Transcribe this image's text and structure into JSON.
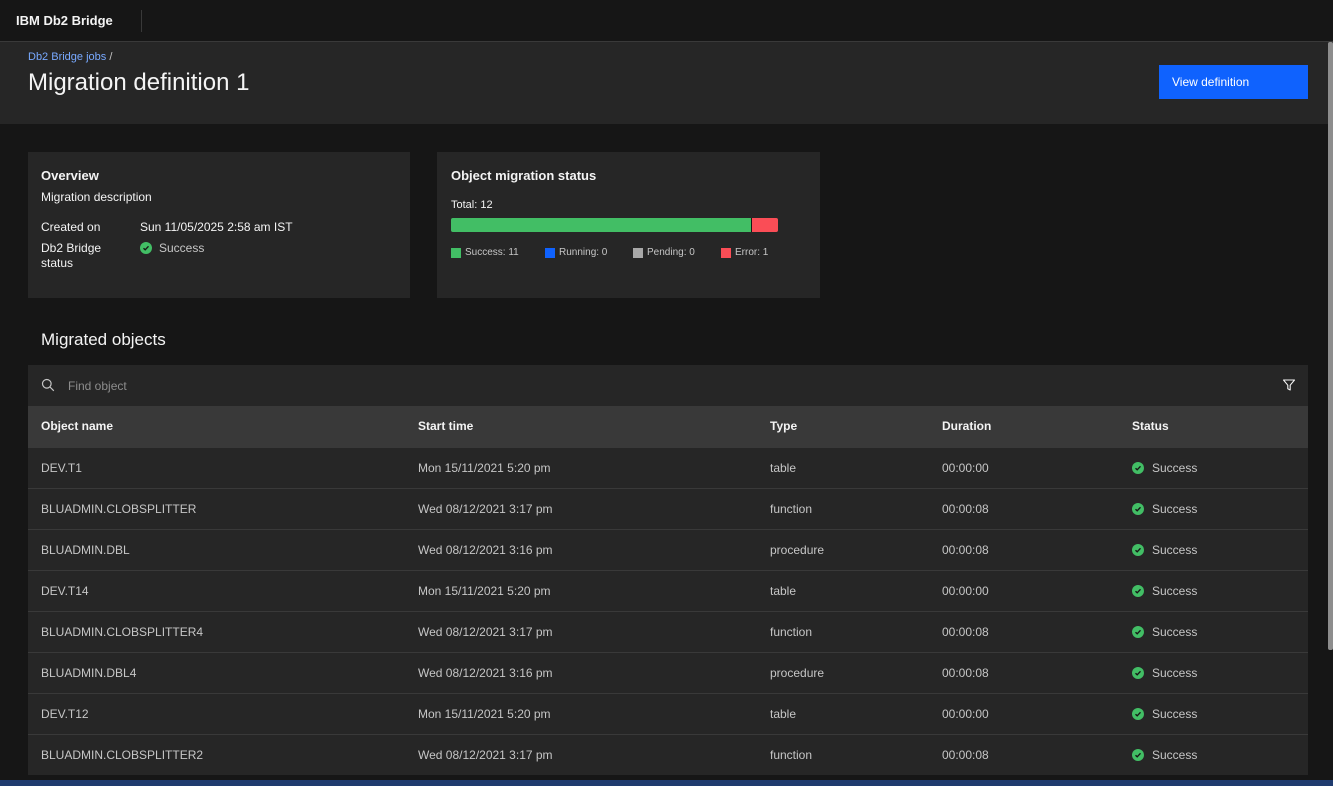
{
  "app": {
    "brand": "IBM Db2 Bridge"
  },
  "header": {
    "breadcrumb_link": "Db2 Bridge jobs",
    "breadcrumb_sep": "/",
    "title": "Migration definition 1",
    "view_button": "View definition"
  },
  "overview": {
    "title": "Overview",
    "description": "Migration description",
    "created_label": "Created on",
    "created_value": "Sun 11/05/2025 2:58 am IST",
    "status_label": "Db2 Bridge status",
    "status_value": "Success"
  },
  "migration_status": {
    "title": "Object migration status",
    "total_label": "Total: 12",
    "total": 12,
    "segments": [
      {
        "key": "success",
        "label": "Success: 11",
        "value": 11,
        "color": "#42be65"
      },
      {
        "key": "running",
        "label": "Running: 0",
        "value": 0,
        "color": "#0f62fe"
      },
      {
        "key": "pending",
        "label": "Pending: 0",
        "value": 0,
        "color": "#a8a8a8"
      },
      {
        "key": "error",
        "label": "Error: 1",
        "value": 1,
        "color": "#fa4d56"
      }
    ]
  },
  "objects": {
    "title": "Migrated objects",
    "search_placeholder": "Find object",
    "columns": [
      "Object name",
      "Start time",
      "Type",
      "Duration",
      "Status"
    ],
    "rows": [
      {
        "name": "DEV.T1",
        "start": "Mon 15/11/2021 5:20 pm",
        "type": "table",
        "duration": "00:00:00",
        "status": "Success"
      },
      {
        "name": "BLUADMIN.CLOBSPLITTER",
        "start": "Wed 08/12/2021 3:17 pm",
        "type": "function",
        "duration": "00:00:08",
        "status": "Success"
      },
      {
        "name": "BLUADMIN.DBL",
        "start": "Wed 08/12/2021 3:16 pm",
        "type": "procedure",
        "duration": "00:00:08",
        "status": "Success"
      },
      {
        "name": "DEV.T14",
        "start": "Mon 15/11/2021 5:20 pm",
        "type": "table",
        "duration": "00:00:00",
        "status": "Success"
      },
      {
        "name": "BLUADMIN.CLOBSPLITTER4",
        "start": "Wed 08/12/2021 3:17 pm",
        "type": "function",
        "duration": "00:00:08",
        "status": "Success"
      },
      {
        "name": "BLUADMIN.DBL4",
        "start": "Wed 08/12/2021 3:16 pm",
        "type": "procedure",
        "duration": "00:00:08",
        "status": "Success"
      },
      {
        "name": "DEV.T12",
        "start": "Mon 15/11/2021 5:20 pm",
        "type": "table",
        "duration": "00:00:00",
        "status": "Success"
      },
      {
        "name": "BLUADMIN.CLOBSPLITTER2",
        "start": "Wed 08/12/2021 3:17 pm",
        "type": "function",
        "duration": "00:00:08",
        "status": "Success"
      }
    ]
  },
  "icons": {
    "search": "search-icon",
    "filter": "filter-icon",
    "success": "checkmark-filled-icon"
  }
}
